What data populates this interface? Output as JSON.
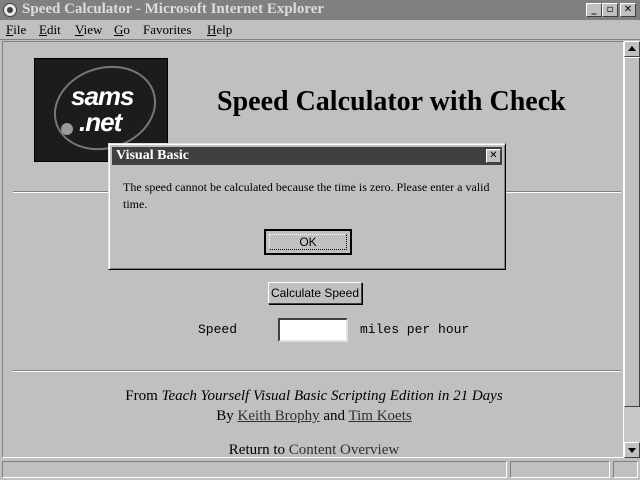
{
  "window": {
    "title": "Speed Calculator - Microsoft Internet Explorer",
    "minimize": "_",
    "maximize": "▫",
    "close": "✕"
  },
  "menu": [
    {
      "accel": "F",
      "rest": "ile"
    },
    {
      "accel": "E",
      "rest": "dit"
    },
    {
      "accel": "V",
      "rest": "iew"
    },
    {
      "accel": "G",
      "rest": "o"
    },
    {
      "accel": "",
      "rest": "Favorites"
    },
    {
      "accel": "H",
      "rest": "elp"
    }
  ],
  "logo": {
    "line1": "sams",
    "line2": ".net"
  },
  "page": {
    "heading": "Speed Calculator with Check",
    "calc_button": "Calculate Speed",
    "speed_label": "Speed",
    "speed_value": "",
    "units_label": "miles per hour",
    "from_prefix": "From ",
    "book_title": "Teach Yourself Visual Basic Scripting Edition in 21 Days",
    "by_prefix": "By ",
    "author1": "Keith Brophy",
    "and_text": " and ",
    "author2": "Tim Koets",
    "return_prefix": "Return to ",
    "return_link": "Content Overview"
  },
  "dialog": {
    "title": "Visual Basic",
    "close": "✕",
    "message": "The speed cannot be calculated because the time is zero. Please enter a valid time.",
    "ok": "OK"
  }
}
